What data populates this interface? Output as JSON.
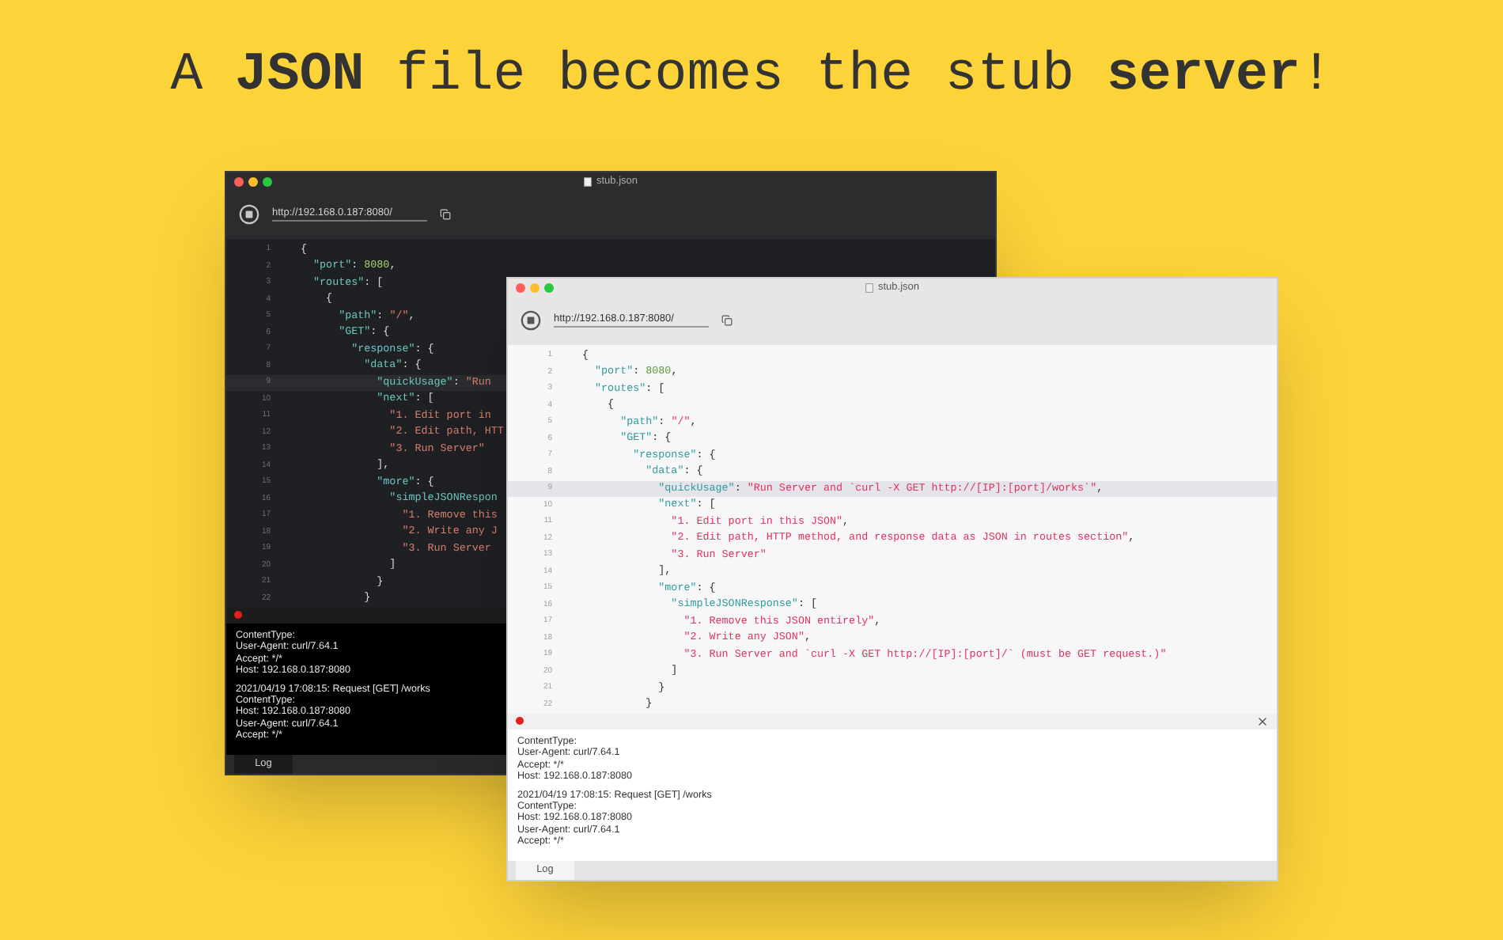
{
  "headline": "A **JSON** file becomes the stub **server**!",
  "windows": [
    {
      "kind": "dark",
      "title": "stub.json",
      "url": "http://192.168.0.187:8080/",
      "lines": [
        {
          "number": "1",
          "current": false,
          "tokens": [
            {
              "kind": "punct",
              "text": "{"
            }
          ]
        },
        {
          "number": "2",
          "current": false,
          "tokens": [
            {
              "kind": "key",
              "text": "  \"port\""
            },
            {
              "kind": "punct",
              "text": ": "
            },
            {
              "kind": "number",
              "text": "8080"
            },
            {
              "kind": "punct",
              "text": ","
            }
          ]
        },
        {
          "number": "3",
          "current": false,
          "tokens": [
            {
              "kind": "key",
              "text": "  \"routes\""
            },
            {
              "kind": "punct",
              "text": ": ["
            }
          ]
        },
        {
          "number": "4",
          "current": false,
          "tokens": [
            {
              "kind": "punct",
              "text": "    {"
            }
          ]
        },
        {
          "number": "5",
          "current": false,
          "tokens": [
            {
              "kind": "key",
              "text": "      \"path\""
            },
            {
              "kind": "punct",
              "text": ": "
            },
            {
              "kind": "string",
              "text": "\"/\""
            },
            {
              "kind": "punct",
              "text": ","
            }
          ]
        },
        {
          "number": "6",
          "current": false,
          "tokens": [
            {
              "kind": "key",
              "text": "      \"GET\""
            },
            {
              "kind": "punct",
              "text": ": {"
            }
          ]
        },
        {
          "number": "7",
          "current": false,
          "tokens": [
            {
              "kind": "key",
              "text": "        \"response\""
            },
            {
              "kind": "punct",
              "text": ": {"
            }
          ]
        },
        {
          "number": "8",
          "current": false,
          "tokens": [
            {
              "kind": "key",
              "text": "          \"data\""
            },
            {
              "kind": "punct",
              "text": ": {"
            }
          ]
        },
        {
          "number": "9",
          "current": true,
          "tokens": [
            {
              "kind": "key",
              "text": "            \"quickUsage\""
            },
            {
              "kind": "punct",
              "text": ": "
            },
            {
              "kind": "string",
              "text": "\"Run"
            }
          ]
        },
        {
          "number": "10",
          "current": false,
          "tokens": [
            {
              "kind": "key",
              "text": "            \"next\""
            },
            {
              "kind": "punct",
              "text": ": ["
            }
          ]
        },
        {
          "number": "11",
          "current": false,
          "tokens": [
            {
              "kind": "string",
              "text": "              \"1. Edit port in"
            }
          ]
        },
        {
          "number": "12",
          "current": false,
          "tokens": [
            {
              "kind": "string",
              "text": "              \"2. Edit path, HTT"
            }
          ]
        },
        {
          "number": "13",
          "current": false,
          "tokens": [
            {
              "kind": "string",
              "text": "              \"3. Run Server\""
            }
          ]
        },
        {
          "number": "14",
          "current": false,
          "tokens": [
            {
              "kind": "punct",
              "text": "            ],"
            }
          ]
        },
        {
          "number": "15",
          "current": false,
          "tokens": [
            {
              "kind": "key",
              "text": "            \"more\""
            },
            {
              "kind": "punct",
              "text": ": {"
            }
          ]
        },
        {
          "number": "16",
          "current": false,
          "tokens": [
            {
              "kind": "key",
              "text": "              \"simpleJSONRespon"
            }
          ]
        },
        {
          "number": "17",
          "current": false,
          "tokens": [
            {
              "kind": "string",
              "text": "                \"1. Remove this"
            }
          ]
        },
        {
          "number": "18",
          "current": false,
          "tokens": [
            {
              "kind": "string",
              "text": "                \"2. Write any J"
            }
          ]
        },
        {
          "number": "19",
          "current": false,
          "tokens": [
            {
              "kind": "string",
              "text": "                \"3. Run Server"
            }
          ]
        },
        {
          "number": "20",
          "current": false,
          "tokens": [
            {
              "kind": "punct",
              "text": "              ]"
            }
          ]
        },
        {
          "number": "21",
          "current": false,
          "tokens": [
            {
              "kind": "punct",
              "text": "            }"
            }
          ]
        },
        {
          "number": "22",
          "current": false,
          "tokens": [
            {
              "kind": "punct",
              "text": "          }"
            }
          ]
        }
      ],
      "log": {
        "closable": false,
        "groups": [
          [
            "ContentType:",
            "User-Agent: curl/7.64.1",
            "Accept: */*",
            "Host: 192.168.0.187:8080"
          ],
          [
            "2021/04/19 17:08:15: Request [GET] /works",
            "ContentType:",
            "Host: 192.168.0.187:8080",
            "User-Agent: curl/7.64.1",
            "Accept: */*"
          ]
        ]
      },
      "tab": "Log"
    },
    {
      "kind": "light",
      "title": "stub.json",
      "url": "http://192.168.0.187:8080/",
      "lines": [
        {
          "number": "1",
          "current": false,
          "tokens": [
            {
              "kind": "punct",
              "text": "{"
            }
          ]
        },
        {
          "number": "2",
          "current": false,
          "tokens": [
            {
              "kind": "key",
              "text": "  \"port\""
            },
            {
              "kind": "punct",
              "text": ": "
            },
            {
              "kind": "number",
              "text": "8080"
            },
            {
              "kind": "punct",
              "text": ","
            }
          ]
        },
        {
          "number": "3",
          "current": false,
          "tokens": [
            {
              "kind": "key",
              "text": "  \"routes\""
            },
            {
              "kind": "punct",
              "text": ": ["
            }
          ]
        },
        {
          "number": "4",
          "current": false,
          "tokens": [
            {
              "kind": "punct",
              "text": "    {"
            }
          ]
        },
        {
          "number": "5",
          "current": false,
          "tokens": [
            {
              "kind": "key",
              "text": "      \"path\""
            },
            {
              "kind": "punct",
              "text": ": "
            },
            {
              "kind": "string",
              "text": "\"/\""
            },
            {
              "kind": "punct",
              "text": ","
            }
          ]
        },
        {
          "number": "6",
          "current": false,
          "tokens": [
            {
              "kind": "key",
              "text": "      \"GET\""
            },
            {
              "kind": "punct",
              "text": ": {"
            }
          ]
        },
        {
          "number": "7",
          "current": false,
          "tokens": [
            {
              "kind": "key",
              "text": "        \"response\""
            },
            {
              "kind": "punct",
              "text": ": {"
            }
          ]
        },
        {
          "number": "8",
          "current": false,
          "tokens": [
            {
              "kind": "key",
              "text": "          \"data\""
            },
            {
              "kind": "punct",
              "text": ": {"
            }
          ]
        },
        {
          "number": "9",
          "current": true,
          "tokens": [
            {
              "kind": "key",
              "text": "            \"quickUsage\""
            },
            {
              "kind": "punct",
              "text": ": "
            },
            {
              "kind": "string",
              "text": "\"Run Server and `curl -X GET http://[IP]:[port]/works`\""
            },
            {
              "kind": "punct",
              "text": ","
            }
          ]
        },
        {
          "number": "10",
          "current": false,
          "tokens": [
            {
              "kind": "key",
              "text": "            \"next\""
            },
            {
              "kind": "punct",
              "text": ": ["
            }
          ]
        },
        {
          "number": "11",
          "current": false,
          "tokens": [
            {
              "kind": "string",
              "text": "              \"1. Edit port in this JSON\""
            },
            {
              "kind": "punct",
              "text": ","
            }
          ]
        },
        {
          "number": "12",
          "current": false,
          "tokens": [
            {
              "kind": "string",
              "text": "              \"2. Edit path, HTTP method, and response data as JSON in routes section\""
            },
            {
              "kind": "punct",
              "text": ","
            }
          ]
        },
        {
          "number": "13",
          "current": false,
          "tokens": [
            {
              "kind": "string",
              "text": "              \"3. Run Server\""
            }
          ]
        },
        {
          "number": "14",
          "current": false,
          "tokens": [
            {
              "kind": "punct",
              "text": "            ],"
            }
          ]
        },
        {
          "number": "15",
          "current": false,
          "tokens": [
            {
              "kind": "key",
              "text": "            \"more\""
            },
            {
              "kind": "punct",
              "text": ": {"
            }
          ]
        },
        {
          "number": "16",
          "current": false,
          "tokens": [
            {
              "kind": "key",
              "text": "              \"simpleJSONResponse\""
            },
            {
              "kind": "punct",
              "text": ": ["
            }
          ]
        },
        {
          "number": "17",
          "current": false,
          "tokens": [
            {
              "kind": "string",
              "text": "                \"1. Remove this JSON entirely\""
            },
            {
              "kind": "punct",
              "text": ","
            }
          ]
        },
        {
          "number": "18",
          "current": false,
          "tokens": [
            {
              "kind": "string",
              "text": "                \"2. Write any JSON\""
            },
            {
              "kind": "punct",
              "text": ","
            }
          ]
        },
        {
          "number": "19",
          "current": false,
          "tokens": [
            {
              "kind": "string",
              "text": "                \"3. Run Server and `curl -X GET http://[IP]:[port]/` (must be GET request.)\""
            }
          ]
        },
        {
          "number": "20",
          "current": false,
          "tokens": [
            {
              "kind": "punct",
              "text": "              ]"
            }
          ]
        },
        {
          "number": "21",
          "current": false,
          "tokens": [
            {
              "kind": "punct",
              "text": "            }"
            }
          ]
        },
        {
          "number": "22",
          "current": false,
          "tokens": [
            {
              "kind": "punct",
              "text": "          }"
            }
          ]
        }
      ],
      "log": {
        "closable": true,
        "groups": [
          [
            "ContentType:",
            "User-Agent: curl/7.64.1",
            "Accept: */*",
            "Host: 192.168.0.187:8080"
          ],
          [
            "2021/04/19 17:08:15: Request [GET] /works",
            "ContentType:",
            "Host: 192.168.0.187:8080",
            "User-Agent: curl/7.64.1",
            "Accept: */*"
          ]
        ]
      },
      "tab": "Log"
    }
  ]
}
